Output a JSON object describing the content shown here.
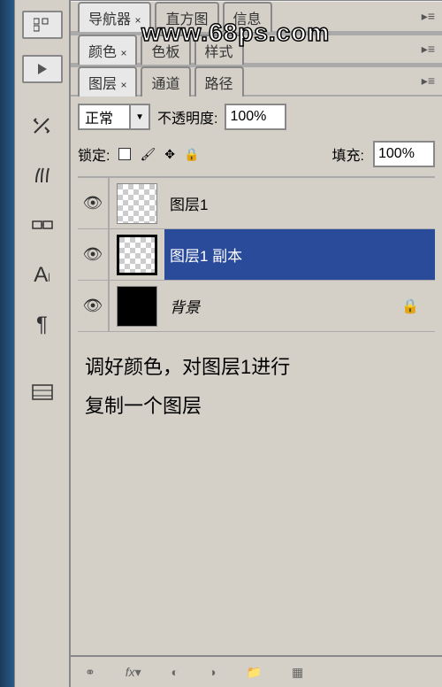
{
  "watermark": "www.68ps.com",
  "nav_tabs": {
    "navigator": "导航器",
    "histogram": "直方图",
    "info": "信息"
  },
  "color_tabs": {
    "color": "颜色",
    "swatches": "色板",
    "styles": "样式"
  },
  "layer_tabs": {
    "layers": "图层",
    "channels": "通道",
    "paths": "路径"
  },
  "blend_mode": "正常",
  "opacity_label": "不透明度:",
  "opacity_value": "100%",
  "lock_label": "锁定:",
  "fill_label": "填充:",
  "fill_value": "100%",
  "layers": [
    {
      "name": "图层1",
      "selected": false,
      "locked": false,
      "type": "checker"
    },
    {
      "name": "图层1 副本",
      "selected": true,
      "locked": false,
      "type": "checker"
    },
    {
      "name": "背景",
      "selected": false,
      "locked": true,
      "type": "black"
    }
  ],
  "instruction_line1": "调好颜色，对图层1进行",
  "instruction_line2": "复制一个图层"
}
